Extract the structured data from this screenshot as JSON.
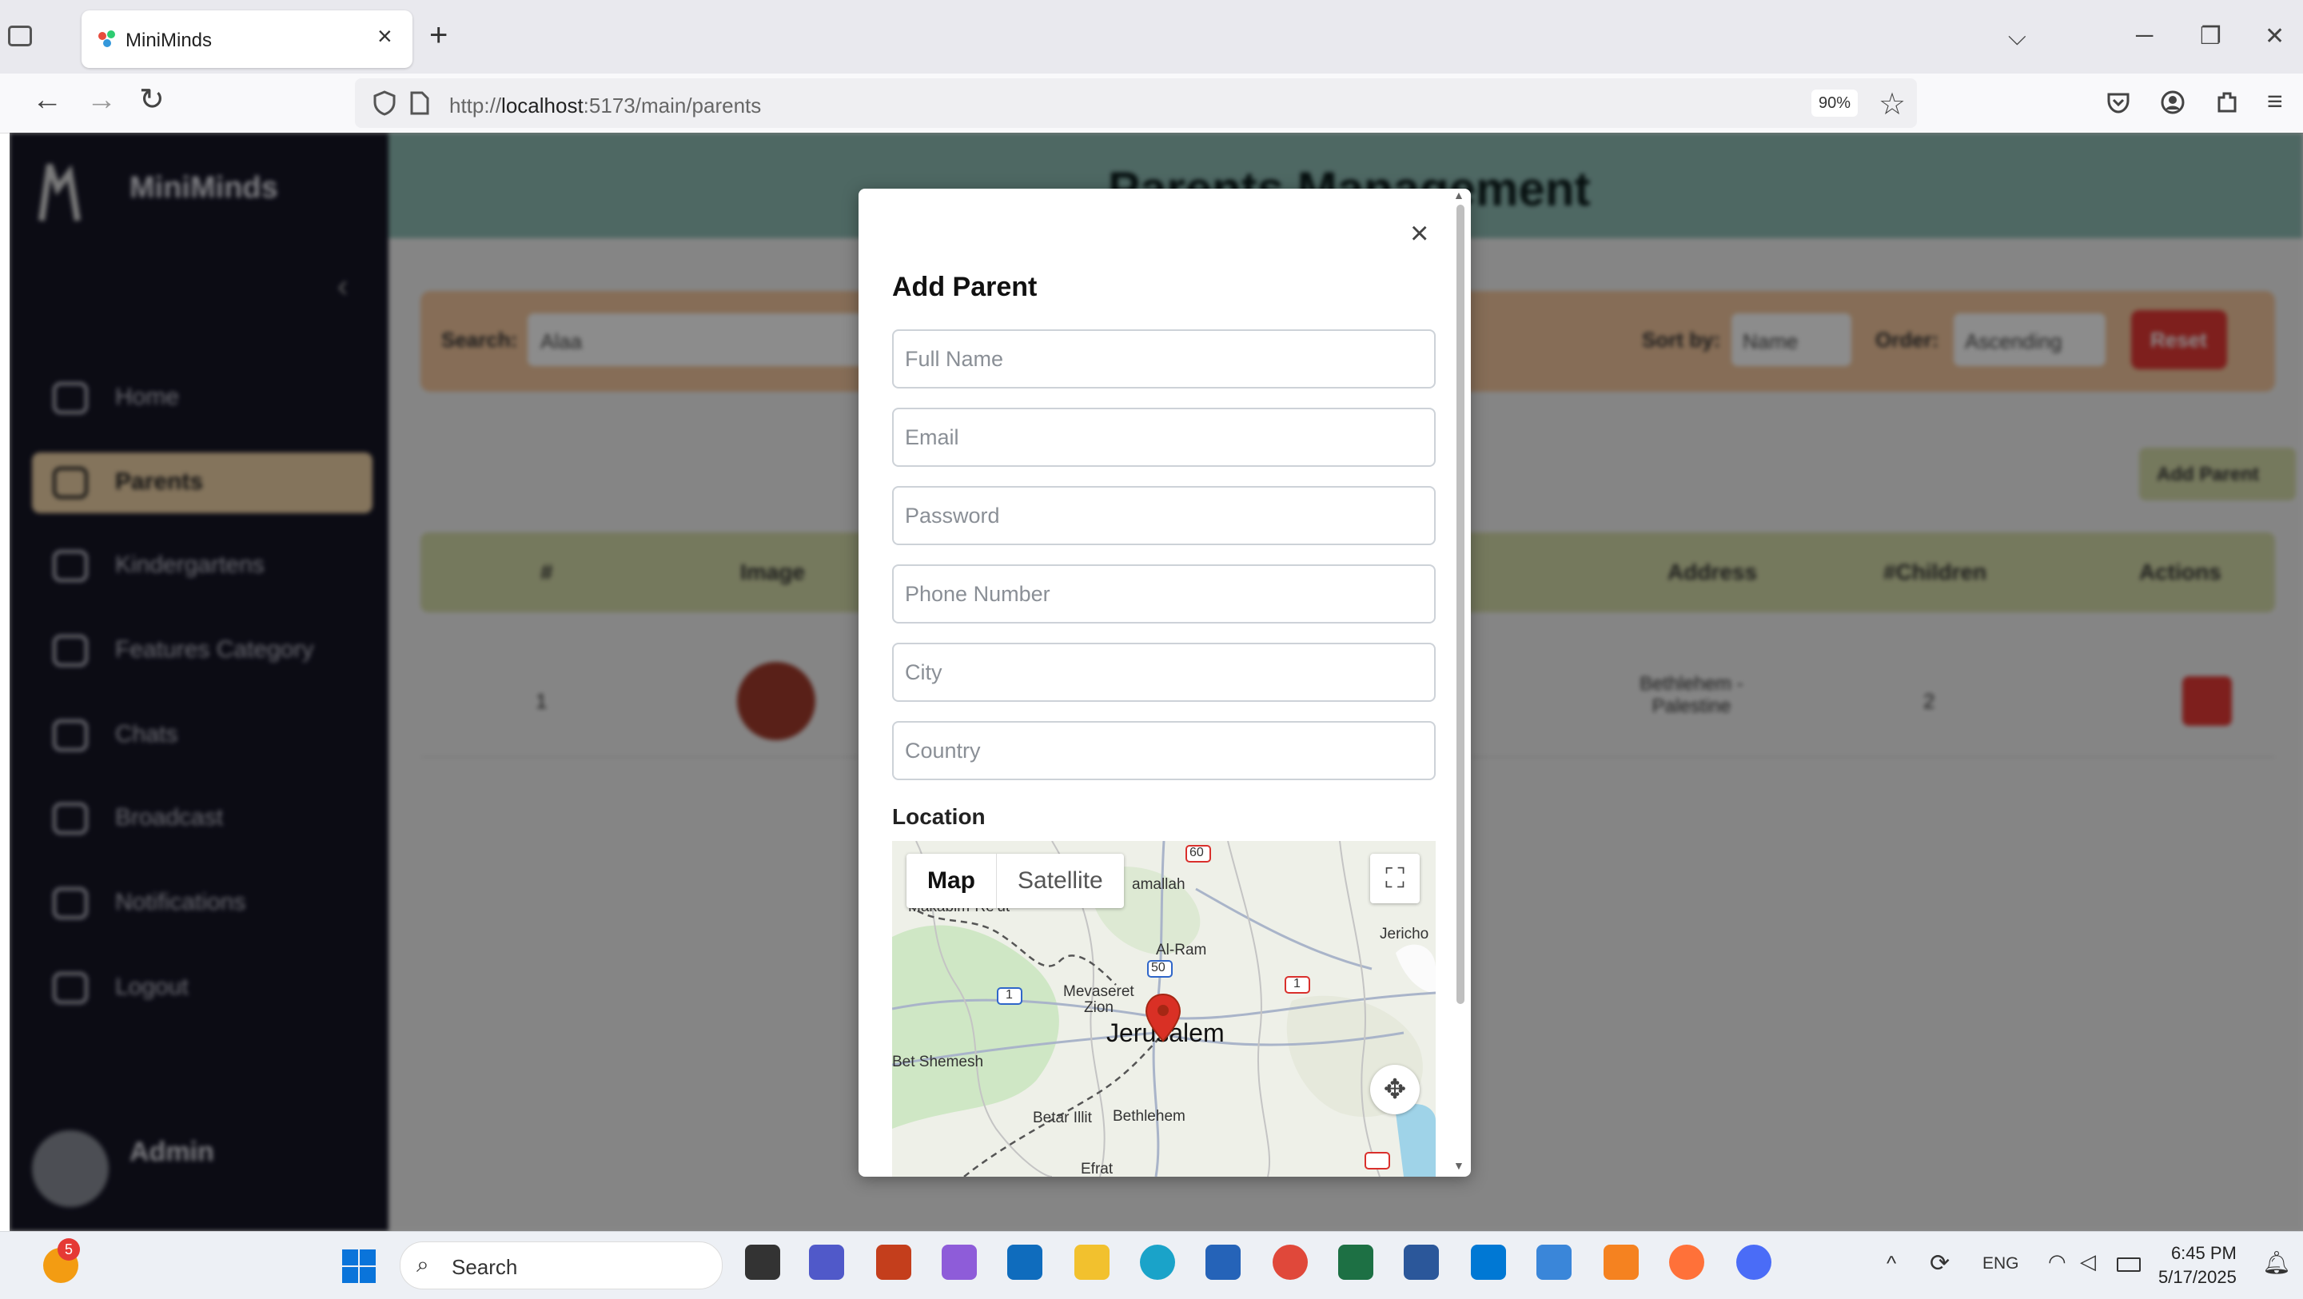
{
  "browser": {
    "tab_title": "MiniMinds",
    "url_prefix": "http://",
    "url_host": "localhost",
    "url_rest": ":5173/main/parents",
    "zoom": "90%",
    "close_glyph": "×",
    "new_tab_glyph": "+"
  },
  "sidebar": {
    "brand": "MiniMinds",
    "items": [
      {
        "label": "Home",
        "icon": "home-icon"
      },
      {
        "label": "Parents",
        "icon": "users-icon",
        "active": true
      },
      {
        "label": "Kindergartens",
        "icon": "building-icon"
      },
      {
        "label": "Features Category",
        "icon": "category-icon"
      },
      {
        "label": "Chats",
        "icon": "chat-icon"
      },
      {
        "label": "Broadcast",
        "icon": "megaphone-icon"
      },
      {
        "label": "Notifications",
        "icon": "bell-icon"
      },
      {
        "label": "Logout",
        "icon": "logout-icon"
      }
    ],
    "user_name": "Admin"
  },
  "main": {
    "title": "Parents Management",
    "filters": {
      "search_label": "Search:",
      "search_value": "Alaa",
      "sort_label": "Sort by:",
      "sort_value": "Name",
      "order_label": "Order:",
      "order_value": "Ascending",
      "reset_label": "Reset"
    },
    "add_button": "Add Parent",
    "table_headers": [
      "#",
      "Image",
      "Address",
      "#Children",
      "Actions"
    ],
    "row": {
      "index": "1",
      "address": "Bethlehem - Palestine",
      "children": "2"
    }
  },
  "modal": {
    "title": "Add Parent",
    "close_glyph": "×",
    "fields": {
      "full_name": "Full Name",
      "email": "Email",
      "password": "Password",
      "phone": "Phone Number",
      "city": "City",
      "country": "Country"
    },
    "location_label": "Location",
    "map": {
      "map_tab": "Map",
      "satellite_tab": "Satellite",
      "places": {
        "jerusalem": "Jerusalem",
        "ramallah": "amallah",
        "jericho": "Jericho",
        "al_ram": "Al-Ram",
        "mevaseret": "Mevaseret",
        "zion": "Zion",
        "bet_shemesh": "Bet Shemesh",
        "bethlehem": "Bethlehem",
        "betar_illit": "Betar Illit",
        "efrat": "Efrat",
        "makabim": "Makabim-Re'ut"
      },
      "road_labels": [
        "60",
        "50",
        "1",
        "1"
      ]
    }
  },
  "taskbar": {
    "search_label": "Search",
    "notification_count": "5",
    "language": "ENG",
    "time": "6:45 PM",
    "date": "5/17/2025"
  },
  "colors": {
    "sidebar_bg": "#161626",
    "header_band": "#8fbdb5",
    "filter_bar": "#f4c79e",
    "table_header": "#d6dcaa",
    "reset_button": "#e53935",
    "marker": "#d93025"
  }
}
